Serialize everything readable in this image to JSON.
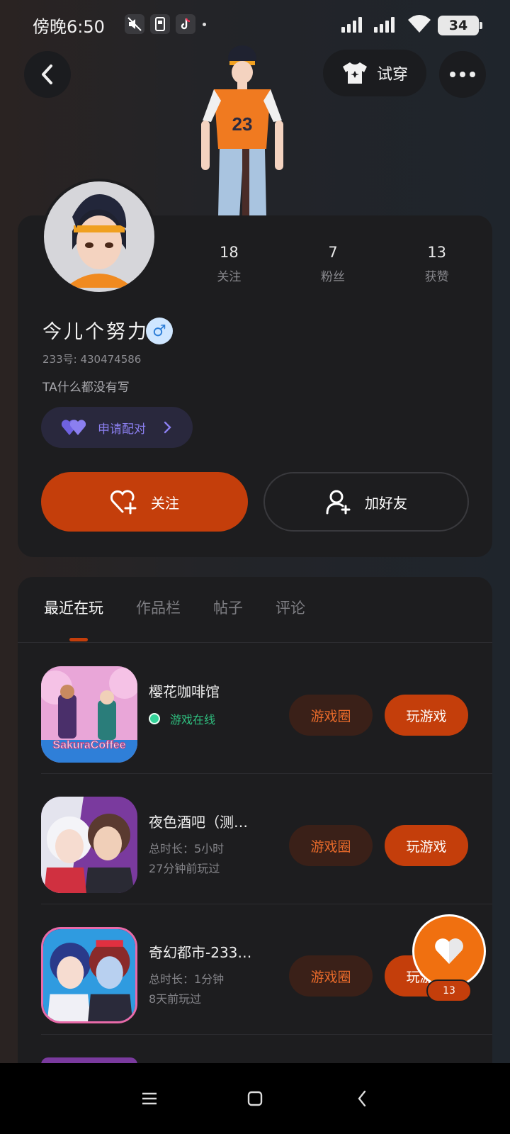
{
  "status_bar": {
    "time": "傍晚6:50",
    "battery": "34"
  },
  "header": {
    "tryon_label": "试穿"
  },
  "profile": {
    "stats": [
      {
        "value": "18",
        "label": "关注"
      },
      {
        "value": "7",
        "label": "粉丝"
      },
      {
        "value": "13",
        "label": "获赞"
      }
    ],
    "nickname": "今儿个努力",
    "gender_symbol": "♂",
    "uid": "233号: 430474586",
    "bio": "TA什么都没有写",
    "pair_label": "申请配对",
    "follow_label": "关注",
    "add_friend_label": "加好友"
  },
  "tabs": [
    "最近在玩",
    "作品栏",
    "帖子",
    "评论"
  ],
  "games": [
    {
      "name": "樱花咖啡馆",
      "status": "游戏在线",
      "circle_label": "游戏圈",
      "play_label": "玩游戏",
      "thumb_text": "SakuraCoffee"
    },
    {
      "name": "夜色酒吧（测…",
      "duration": "总时长：5小时",
      "last_played": "27分钟前玩过",
      "circle_label": "游戏圈",
      "play_label": "玩游戏"
    },
    {
      "name": "奇幻都市-233…",
      "duration": "总时长：1分钟",
      "last_played": "8天前玩过",
      "circle_label": "游戏圈",
      "play_label": "玩游戏"
    }
  ],
  "like_fab": {
    "count": "13"
  },
  "colors": {
    "accent": "#c43e0b",
    "card": "#1d1d1f",
    "online": "#34d399",
    "pair": "#8b7ff0"
  },
  "icons": [
    "back-icon",
    "tshirt-icon",
    "more-icon",
    "heart-plus-icon",
    "user-plus-icon",
    "hearts-icon",
    "chevron-right-icon",
    "heart-icon",
    "menu-icon",
    "home-icon",
    "nav-back-icon"
  ]
}
